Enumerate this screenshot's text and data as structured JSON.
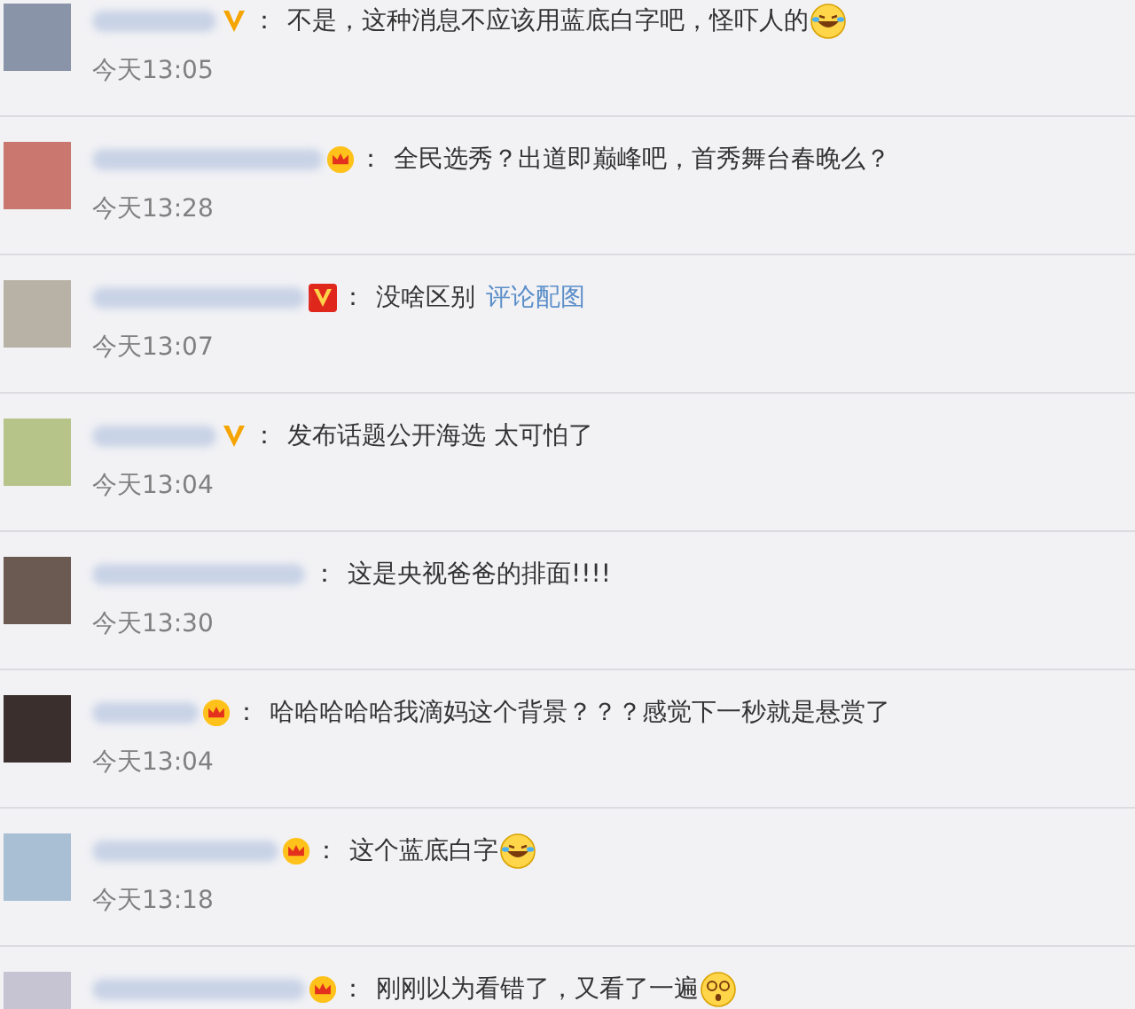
{
  "comments": [
    {
      "badge": {
        "kind": "v-gold"
      },
      "colon": "：",
      "text": "不是，这种消息不应该用蓝底白字吧，怪吓人的",
      "emoji": {
        "kind": "laugh-cry"
      },
      "time": "今天13:05"
    },
    {
      "badge": {
        "kind": "crown"
      },
      "colon": "：",
      "text": "全民选秀？出道即巅峰吧，首秀舞台春晚么？",
      "time": "今天13:28"
    },
    {
      "badge": {
        "kind": "v-red"
      },
      "colon": "：",
      "text": "没啥区别",
      "link": "评论配图",
      "time": "今天13:07"
    },
    {
      "badge": {
        "kind": "v-gold"
      },
      "colon": "：",
      "text": "发布话题公开海选 太可怕了",
      "time": "今天13:04"
    },
    {
      "colon": "：",
      "text": "这是央视爸爸的排面!!!!",
      "time": "今天13:30"
    },
    {
      "badge": {
        "kind": "crown"
      },
      "colon": "：",
      "text": "哈哈哈哈哈我滴妈这个背景？？？感觉下一秒就是悬赏了",
      "time": "今天13:04"
    },
    {
      "badge": {
        "kind": "crown"
      },
      "colon": "：",
      "text": "这个蓝底白字",
      "emoji": {
        "kind": "laugh-cry"
      },
      "time": "今天13:18"
    },
    {
      "badge": {
        "kind": "crown"
      },
      "colon": "：",
      "text": "刚刚以为看错了，又看了一遍",
      "emoji": {
        "kind": "dizzy"
      }
    }
  ]
}
